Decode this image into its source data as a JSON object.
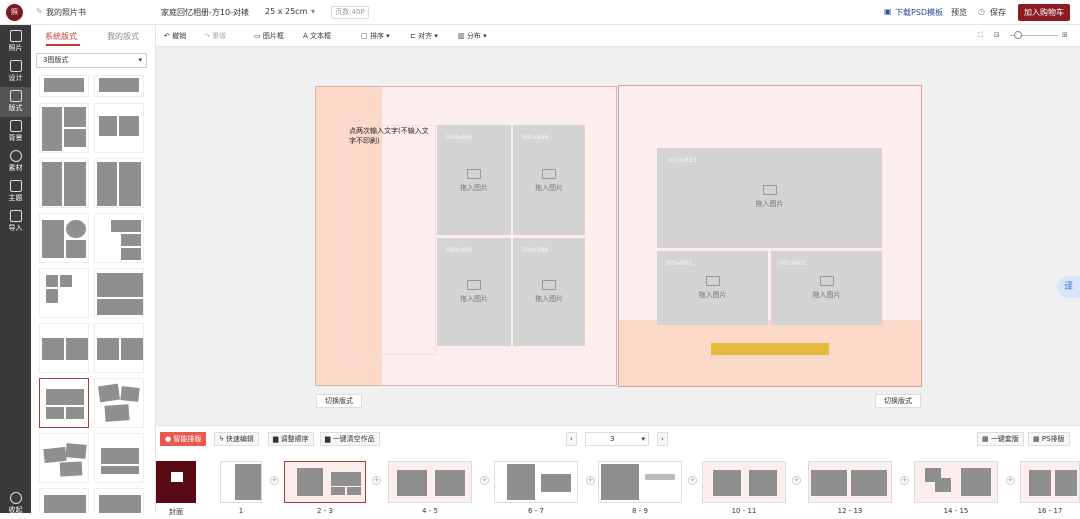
{
  "header": {
    "logo_text": "照",
    "book_name": "我的照片书",
    "product": "家庭回忆相册-方10-对裱",
    "size": "25 x 25cm",
    "pages": "页数:40P",
    "download": "下载PSD模板",
    "preview": "预览",
    "save": "保存",
    "cart": "加入购物车"
  },
  "nav": [
    "照片",
    "设计",
    "版式",
    "背景",
    "素材",
    "主题",
    "导入",
    "收起"
  ],
  "panel": {
    "tabs": [
      "系统版式",
      "我的版式"
    ],
    "filter": "3图版式"
  },
  "toolbar": {
    "undo": "撤销",
    "redo": "重做",
    "image_frame": "图片框",
    "text_frame": "文本框",
    "sort": "排序",
    "align": "对齐",
    "distribute": "分布"
  },
  "canvas": {
    "text_prompt": "点两次输入文字(不输入文字不印刷)",
    "cells_left": [
      {
        "size": "590x886",
        "label": "拖入图片"
      },
      {
        "size": "590x886",
        "label": "拖入图片"
      },
      {
        "size": "590x886",
        "label": "拖入图片"
      },
      {
        "size": "590x886",
        "label": "拖入图片"
      }
    ],
    "cells_right": [
      {
        "size": "1820x813",
        "label": "拖入图片"
      },
      {
        "size": "905x601",
        "label": "拖入图片"
      },
      {
        "size": "905x601",
        "label": "拖入图片"
      }
    ],
    "switch_layout": "切换版式",
    "accent_color": "#e6b93c"
  },
  "bottom": {
    "smart": "智能排版",
    "quick": "快速编辑",
    "reorder": "调整顺序",
    "clear": "一键清空作品",
    "page_value": "3",
    "one_click": "一键套版",
    "ps_layout": "PS排版",
    "labels": [
      "封面",
      "1",
      "2 - 3",
      "4 - 5",
      "6 - 7",
      "8 - 9",
      "10 - 11",
      "12 - 13",
      "14 - 15",
      "16 - 17"
    ]
  },
  "float_label": "译"
}
